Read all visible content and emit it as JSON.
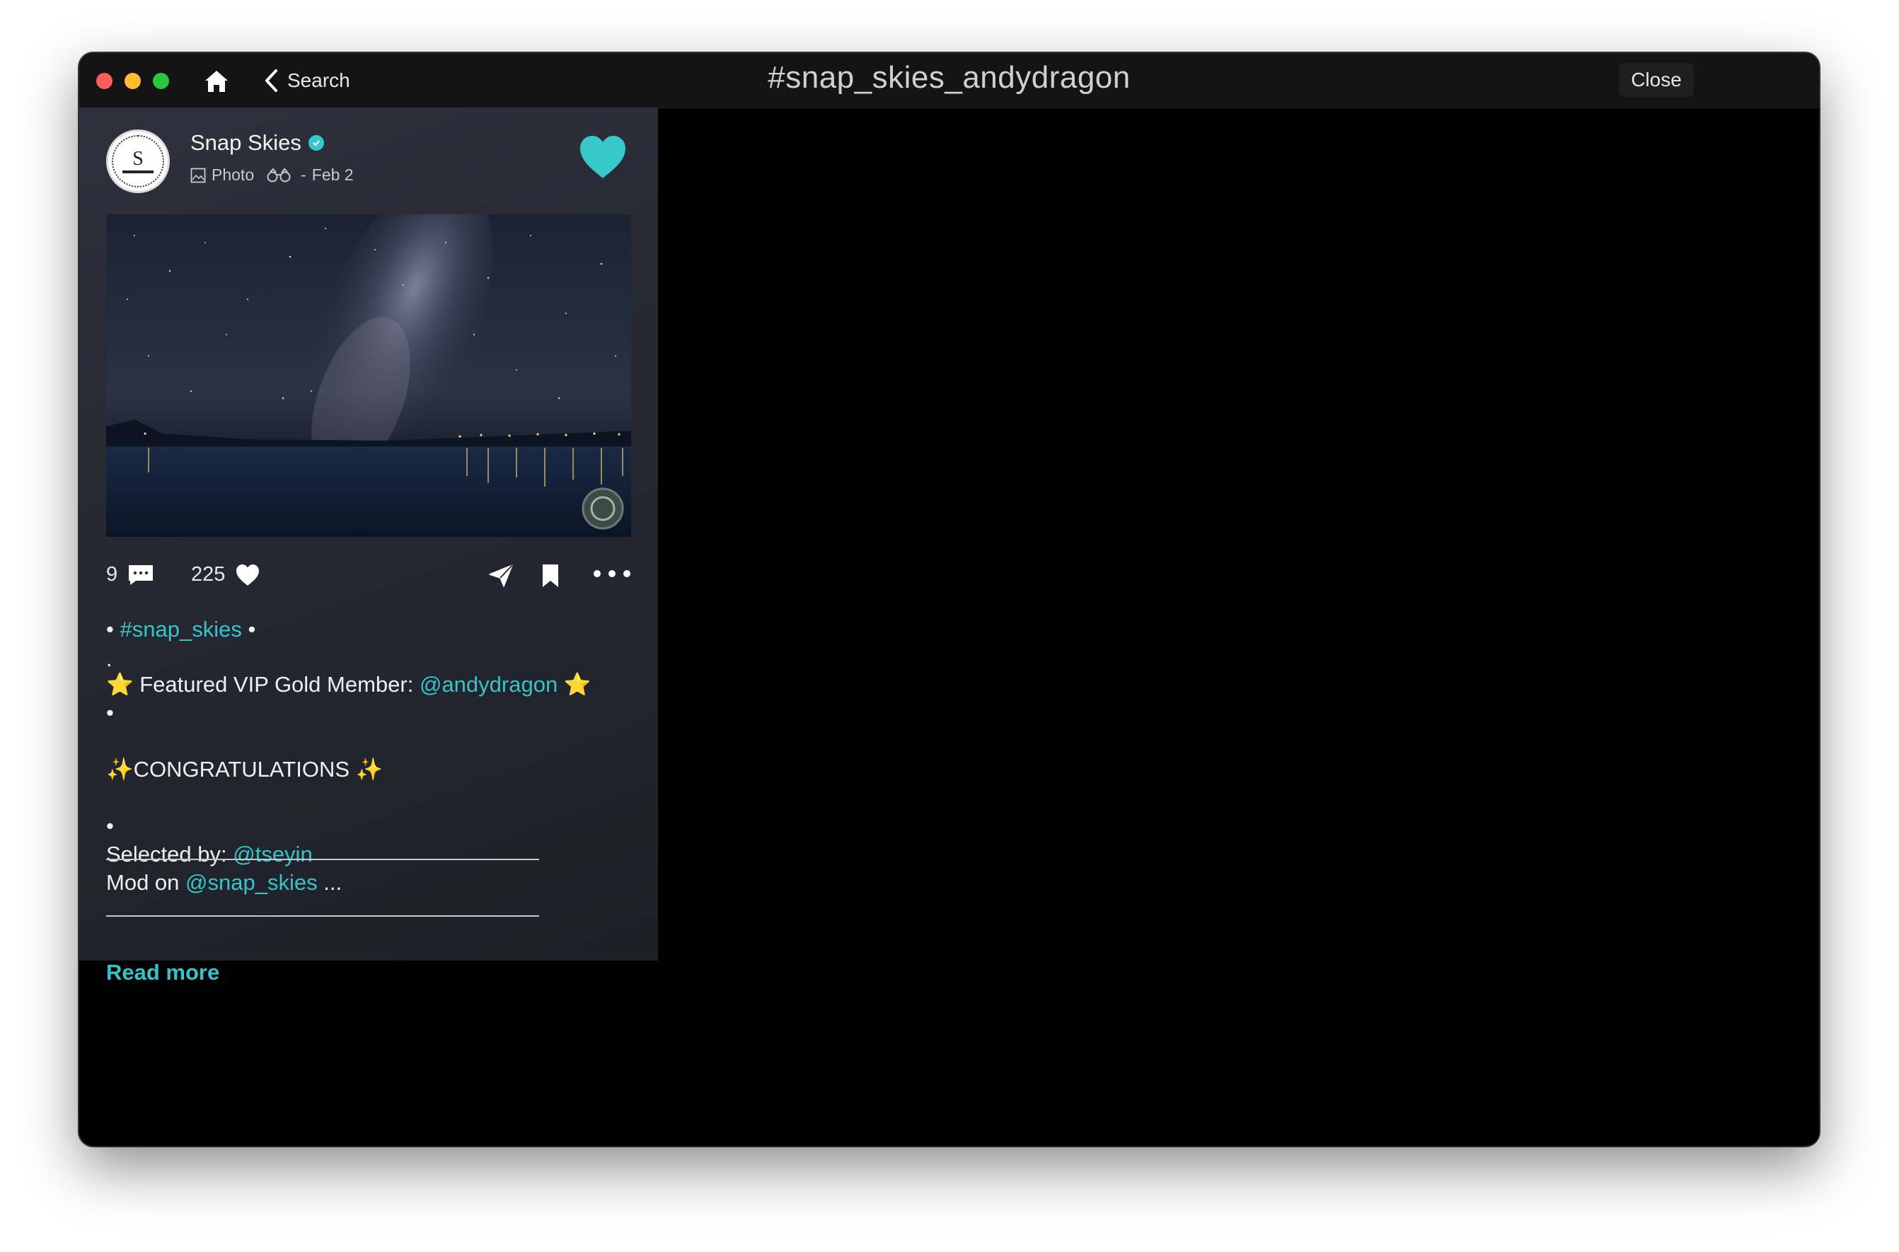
{
  "titlebar": {
    "back_label": "Search",
    "title": "#snap_skies_andydragon",
    "close_label": "Close"
  },
  "post": {
    "author": "Snap Skies",
    "avatar_letter": "S",
    "type_label": "Photo",
    "separator": "-",
    "date": "Feb 2",
    "comments_count": "9",
    "likes_count": "225",
    "liked": true,
    "icons": [
      "home-icon",
      "chevron-left-icon",
      "verified-icon",
      "photo-icon",
      "binoculars-icon",
      "heart-icon",
      "comment-icon",
      "share-icon",
      "bookmark-icon",
      "more-icon"
    ]
  },
  "caption": {
    "line1_bullet_left": "•",
    "line1_hashtag": "#snap_skies",
    "line1_bullet_right": "•",
    "line2_dot": ".",
    "line3_star_left": "⭐",
    "line3_text": "Featured VIP Gold Member:",
    "line3_mention": "@andydragon",
    "line3_star_right": "⭐",
    "line4_bullet": "•",
    "line5_text": "✨CONGRATULATIONS ✨",
    "line6_bullet": "•",
    "line7_text": "Selected by:",
    "line7_mention": "@tseyin",
    "line8_text": "Mod on",
    "line8_mention": "@snap_skies",
    "line8_ellipsis": "...",
    "read_more": "Read more"
  },
  "colors": {
    "accent": "#37c4c8",
    "window_bg": "#000000",
    "card_bg": "#2a2d36"
  }
}
